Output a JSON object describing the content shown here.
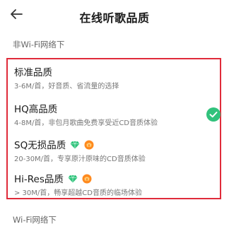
{
  "header": {
    "back_icon": "arrow-left-icon",
    "title": "在线听歌品质"
  },
  "sections": [
    {
      "label": "非Wi-Fi网络下",
      "options": [
        {
          "title": "标准品质",
          "desc": "3-6M/首，好音质、省流量的选择",
          "selected": false,
          "badges": []
        },
        {
          "title": "HQ高品质",
          "desc": "4-8M/首，非包月歌曲免费享受近CD音质体验",
          "selected": true,
          "badges": []
        },
        {
          "title": "SQ无损品质",
          "desc": "20-30M/首，专享原汁原味的CD音质体验",
          "selected": false,
          "badges": [
            "diamond-vip-icon",
            "orange-vip-icon"
          ]
        },
        {
          "title": "Hi-Res品质",
          "desc": "> 30M/首，畅享超越CD音质的临场体验",
          "selected": false,
          "badges": [
            "diamond-vip-icon",
            "orange-vip-icon"
          ]
        }
      ]
    },
    {
      "label": "Wi-Fi网络下"
    }
  ],
  "colors": {
    "highlight_border": "#e02b3a",
    "check_green": "#31c27c",
    "diamond_green": "#2ec27a",
    "badge_orange": "#ff8a1f"
  }
}
